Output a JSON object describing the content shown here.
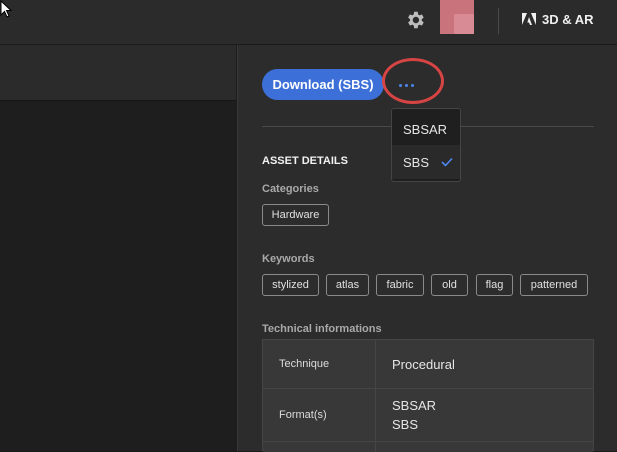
{
  "header": {
    "brand_label": "3D & AR"
  },
  "actions": {
    "download_label": "Download (SBS)"
  },
  "format_menu": {
    "items": [
      {
        "label": "SBSAR"
      },
      {
        "label": "SBS"
      }
    ],
    "selected": "SBS"
  },
  "asset": {
    "section_title": "ASSET DETAILS",
    "categories_label": "Categories",
    "categories": [
      "Hardware"
    ],
    "keywords_label": "Keywords",
    "keywords": [
      "stylized",
      "atlas",
      "fabric",
      "old",
      "flag",
      "patterned"
    ],
    "tech_label": "Technical informations",
    "tech": {
      "rows": [
        {
          "key": "Technique",
          "values": [
            "Procedural"
          ]
        },
        {
          "key": "Format(s)",
          "values": [
            "SBSAR",
            "SBS"
          ]
        }
      ]
    }
  },
  "colors": {
    "accent": "#3c6fd7",
    "highlight": "#d74444",
    "panel": "#2c2c2c"
  }
}
